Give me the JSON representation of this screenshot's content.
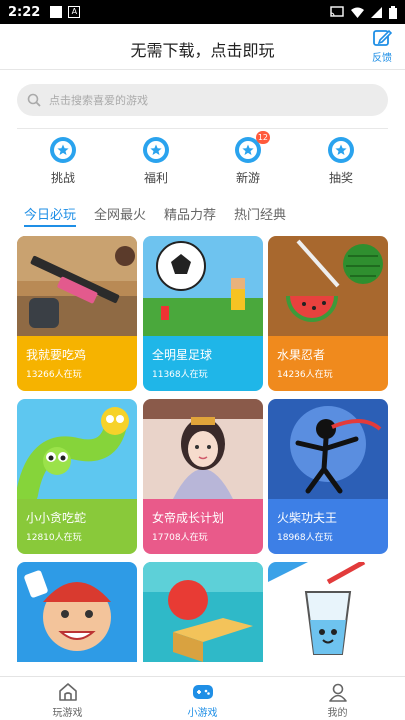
{
  "status_bar": {
    "time": "2:22"
  },
  "header": {
    "title": "无需下载，点击即玩",
    "feedback_label": "反馈"
  },
  "search": {
    "placeholder": "点击搜索喜爱的游戏"
  },
  "quick_actions": [
    {
      "label": "挑战",
      "icon": "star-badge-icon"
    },
    {
      "label": "福利",
      "icon": "star-badge-icon"
    },
    {
      "label": "新游",
      "icon": "star-badge-icon",
      "badge": "12"
    },
    {
      "label": "抽奖",
      "icon": "star-badge-icon"
    }
  ],
  "tabs": [
    "今日必玩",
    "全网最火",
    "精品力荐",
    "热门经典"
  ],
  "active_tab": "今日必玩",
  "games": [
    {
      "name": "我就要吃鸡",
      "players": "13266人在玩",
      "color": "#f6b300"
    },
    {
      "name": "全明星足球",
      "players": "11368人在玩",
      "color": "#1fb6e8"
    },
    {
      "name": "水果忍者",
      "players": "14236人在玩",
      "color": "#f08a1d"
    },
    {
      "name": "小小贪吃蛇",
      "players": "12810人在玩",
      "color": "#89c93a"
    },
    {
      "name": "女帝成长计划",
      "players": "17708人在玩",
      "color": "#e95a8a"
    },
    {
      "name": "火柴功夫王",
      "players": "18968人在玩",
      "color": "#3d7fe6"
    },
    {
      "name": "",
      "players": "",
      "color": "#e04b3b"
    },
    {
      "name": "",
      "players": "",
      "color": "#23b7c9"
    },
    {
      "name": "",
      "players": "",
      "color": "#3aa1e8"
    }
  ],
  "bottom_nav": [
    {
      "label": "玩游戏",
      "icon": "home-icon"
    },
    {
      "label": "小游戏",
      "icon": "gamepad-icon"
    },
    {
      "label": "我的",
      "icon": "user-icon"
    }
  ],
  "active_nav": "小游戏",
  "colors": {
    "accent": "#1f8fe6"
  }
}
